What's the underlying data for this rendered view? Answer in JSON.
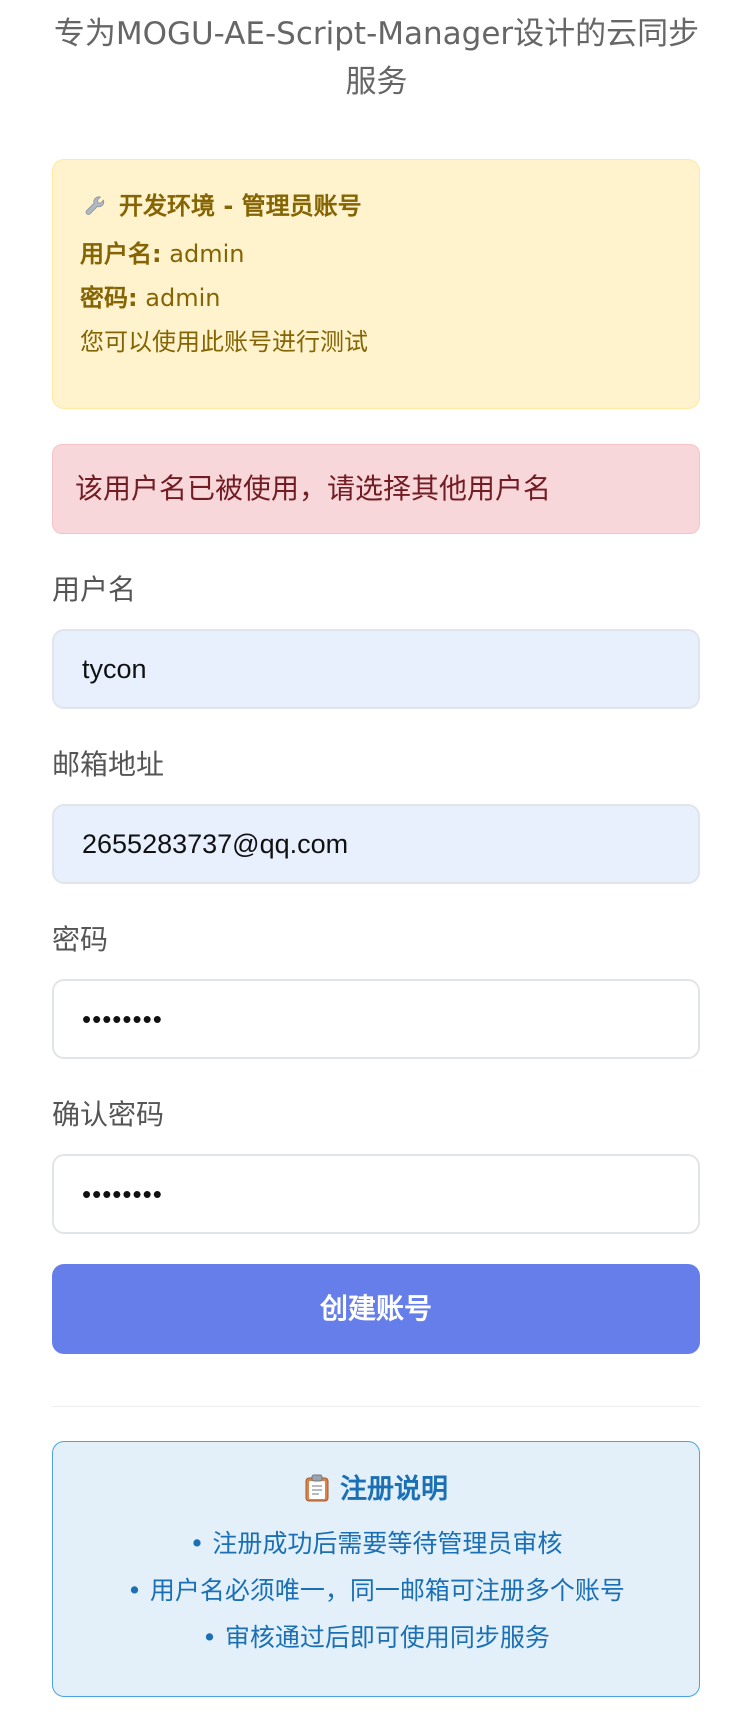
{
  "header": {
    "subtitle": "专为MOGU-AE-Script-Manager设计的云同步服务"
  },
  "dev_notice": {
    "icon": "wrench-icon",
    "title": "开发环境 - 管理员账号",
    "username_label": "用户名:",
    "username_value": "admin",
    "password_label": "密码:",
    "password_value": "admin",
    "hint": "您可以使用此账号进行测试"
  },
  "error_alert": {
    "message": "该用户名已被使用，请选择其他用户名"
  },
  "form": {
    "username": {
      "label": "用户名",
      "value": "tycon"
    },
    "email": {
      "label": "邮箱地址",
      "value": "2655283737@qq.com"
    },
    "password": {
      "label": "密码",
      "value": "••••••••"
    },
    "confirm_password": {
      "label": "确认密码",
      "value": "••••••••"
    },
    "submit_label": "创建账号"
  },
  "info": {
    "icon": "clipboard-icon",
    "title": "注册说明",
    "items": [
      "• 注册成功后需要等待管理员审核",
      "• 用户名必须唯一，同一邮箱可注册多个账号",
      "• 审核通过后即可使用同步服务"
    ]
  },
  "colors": {
    "primary": "#667eea",
    "warning_bg": "#fff3cd",
    "warning_text": "#856404",
    "error_bg": "#f8d7da",
    "error_text": "#721c24",
    "info_bg": "#e3f0fa",
    "info_text": "#1a6fb5",
    "autofill_bg": "#e8f0fe"
  }
}
